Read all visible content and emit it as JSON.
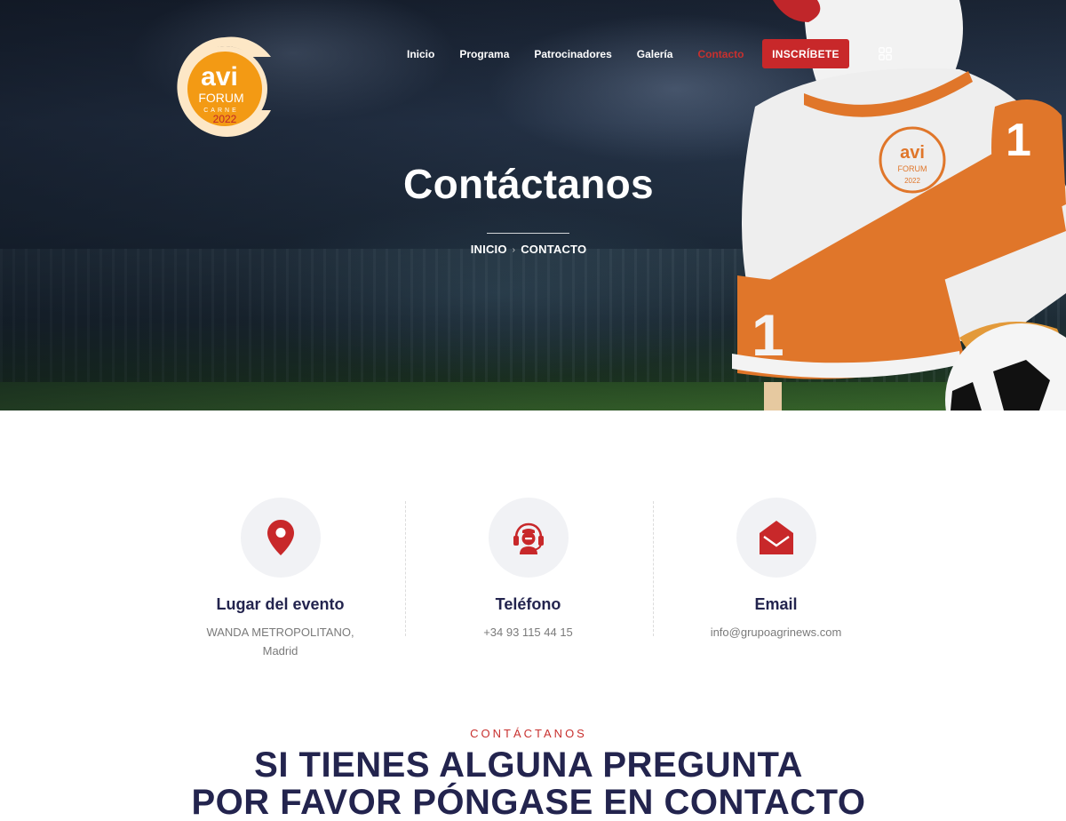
{
  "logo": {
    "brand": "avi",
    "line1": "FORUM",
    "line2": "CARNE",
    "year": "2022"
  },
  "nav": {
    "items": [
      "Inicio",
      "Programa",
      "Patrocinadores",
      "Galería",
      "Contacto"
    ],
    "active": "Contacto",
    "cta_label": "INSCRÍBETE",
    "menu_icon": "grid-icon"
  },
  "hero": {
    "title": "Contáctanos",
    "breadcrumb": {
      "home": "INICIO",
      "separator": "›",
      "current": "CONTACTO"
    },
    "jersey_number": "1"
  },
  "contact": [
    {
      "icon": "map-pin-icon",
      "title": "Lugar del evento",
      "line1": "WANDA METROPOLITANO,",
      "line2": "Madrid"
    },
    {
      "icon": "headset-icon",
      "title": "Teléfono",
      "line1": "+34 93 115 44 15",
      "line2": ""
    },
    {
      "icon": "envelope-icon",
      "title": "Email",
      "line1": "info@grupoagrinews.com",
      "line2": ""
    }
  ],
  "section": {
    "kicker": "CONTÁCTANOS",
    "heading_line1": "SI TIENES ALGUNA PREGUNTA",
    "heading_line2": "POR FAVOR PÓNGASE EN CONTACTO"
  },
  "colors": {
    "accent": "#c8282a",
    "heading": "#23244e",
    "logo_orange": "#f39a14",
    "logo_cream": "#fde7c6"
  }
}
